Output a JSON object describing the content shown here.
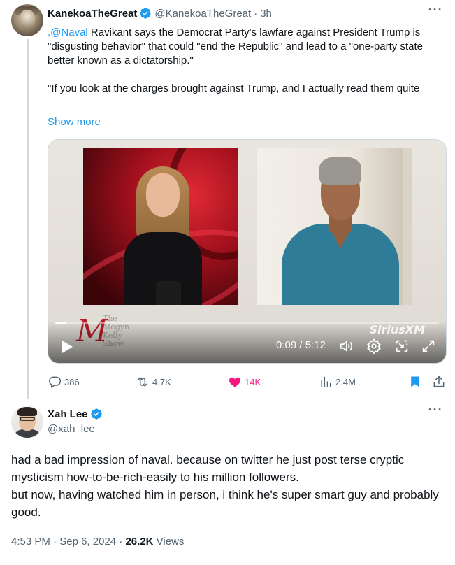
{
  "tweet1": {
    "display_name": "KanekoaTheGreat",
    "handle": "@KanekoaTheGreat",
    "separator": "·",
    "age": "3h",
    "more": "···",
    "mention": ".@Naval",
    "text_part1": " Ravikant says the Democrat Party's lawfare against President Trump is \"disgusting behavior\" that could \"end the Republic\" and lead to a \"one-party state better known as a dictatorship.\"",
    "text_part2": "\"If you look at the charges brought against Trump, and I actually read them quite",
    "show_more": "Show more",
    "video": {
      "elapsed": "0:09",
      "duration": "5:12",
      "time_display": "0:09 / 5:12",
      "progress": 0.03,
      "logo_letter": "M",
      "logo_text": "The Megyn Kelly Show",
      "watermark": "SiriusXM"
    },
    "actions": {
      "replies": "386",
      "reposts": "4.7K",
      "likes": "14K",
      "views": "2.4M"
    },
    "colors": {
      "link": "#1d9bf0",
      "like": "#f91880",
      "bookmark": "#1d9bf0",
      "muted": "#536471"
    }
  },
  "tweet2": {
    "display_name": "Xah Lee",
    "handle": "@xah_lee",
    "more": "···",
    "paragraph1": "had a bad impression of naval. because on twitter he just post terse cryptic mysticism how-to-be-rich-easily to his million followers.",
    "paragraph2": "but now, having watched him in person, i think he's super smart guy and probably good.",
    "time": "4:53 PM",
    "date": "Sep 6, 2024",
    "separator": "·",
    "views_count": "26.2K",
    "views_label": " Views"
  },
  "icons": [
    "verified-badge-icon",
    "more-icon",
    "play-icon",
    "volume-icon",
    "settings-icon",
    "dock-icon",
    "fullscreen-icon",
    "reply-icon",
    "retweet-icon",
    "like-icon",
    "views-icon",
    "bookmark-icon",
    "share-icon"
  ]
}
